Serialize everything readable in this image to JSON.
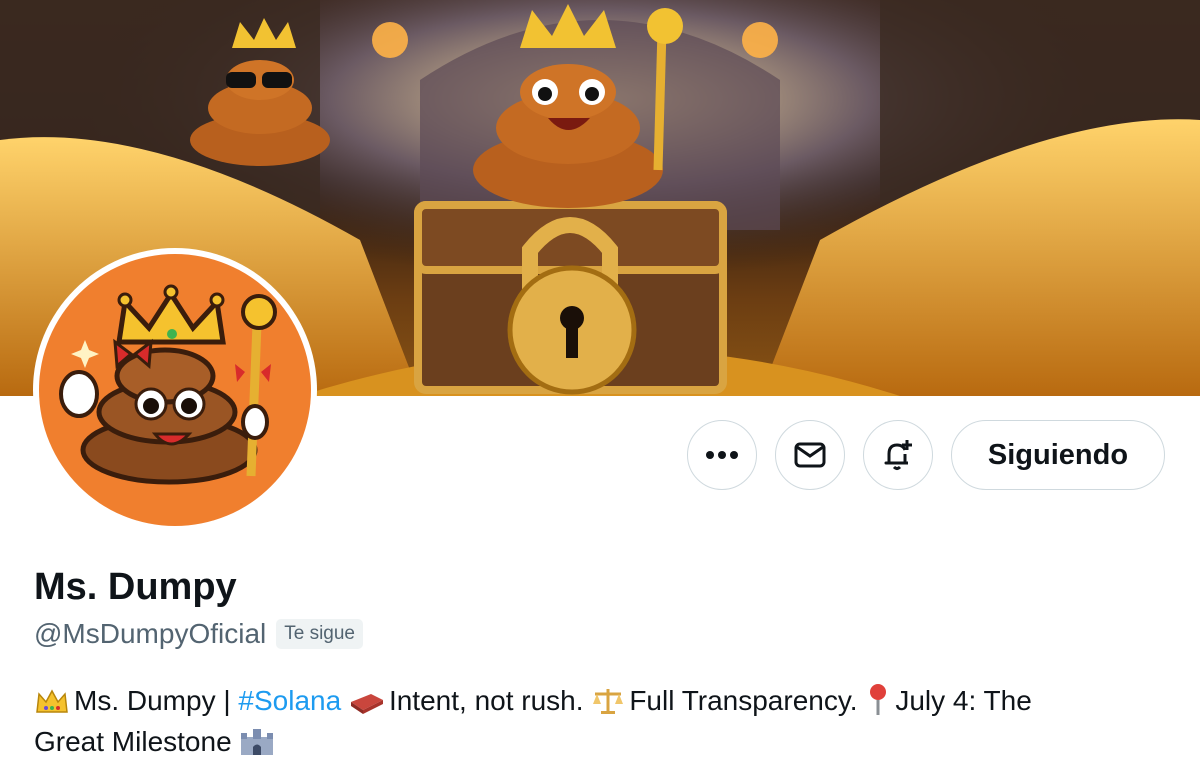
{
  "profile": {
    "display_name": "Ms. Dumpy",
    "handle": "@MsDumpyOficial",
    "follows_you_badge": "Te sigue",
    "bio": {
      "part1": "Ms. Dumpy | ",
      "hashtag": "#Solana",
      "part2": "Intent, not rush.",
      "part3": "Full Transparency.",
      "part4": "July 4: The",
      "part5": "Great Milestone"
    }
  },
  "actions": {
    "follow_button": "Siguiendo"
  },
  "icons": [
    "more-icon",
    "message-icon",
    "notification-bell-icon",
    "crown-emoji",
    "brick-emoji",
    "scales-emoji",
    "pin-emoji",
    "castle-emoji"
  ],
  "colors": {
    "hashtag": "#1d9bf0",
    "avatar_bg": "#f07f2e",
    "muted_text": "#536471"
  }
}
